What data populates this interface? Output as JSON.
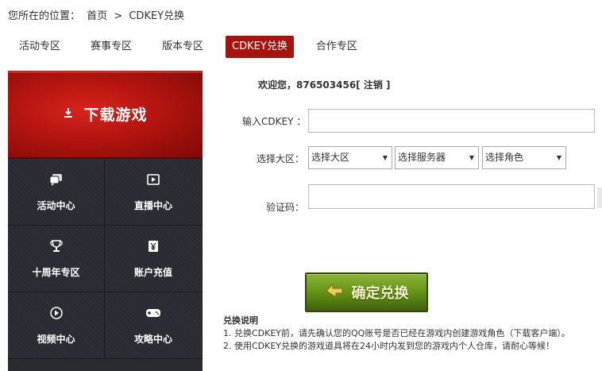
{
  "breadcrumb": {
    "prefix": "您所在的位置：",
    "home": "首页",
    "separator": ">",
    "current": "CDKEY兑换"
  },
  "tabs": [
    {
      "label": "活动专区",
      "active": false
    },
    {
      "label": "赛事专区",
      "active": false
    },
    {
      "label": "版本专区",
      "active": false
    },
    {
      "label": "CDKEY兑换",
      "active": true
    },
    {
      "label": "合作专区",
      "active": false
    }
  ],
  "sidebar": {
    "download_label": "下载游戏",
    "items": [
      {
        "label": "活动中心",
        "icon": "chat-icon"
      },
      {
        "label": "直播中心",
        "icon": "play-screen-icon"
      },
      {
        "label": "十周年专区",
        "icon": "trophy-icon"
      },
      {
        "label": "账户充值",
        "icon": "yen-icon"
      },
      {
        "label": "视频中心",
        "icon": "play-circle-icon"
      },
      {
        "label": "攻略中心",
        "icon": "gamepad-icon"
      }
    ]
  },
  "form": {
    "welcome_prefix": "欢迎您，",
    "username": "876503456",
    "logout": "[ 注销 ]",
    "cdkey_label": "输入CDKEY ：",
    "cdkey_value": "",
    "region_label": "选择大区：",
    "select_region": "选择大区",
    "select_server": "选择服务器",
    "select_role": "选择角色",
    "captcha_label": "验证码：",
    "captcha_value": "",
    "confirm_label": "确定兑换"
  },
  "notes": {
    "title": "兑换说明",
    "line1": "1. 兑换CDKEY前，请先确认您的QQ账号是否已经在游戏内创建游戏角色（下载客户端）。",
    "line2": "2. 使用CDKEY兑换的游戏道具将在24小时内发到您的游戏内个人仓库，请耐心等候！"
  },
  "colors": {
    "accent": "#a71410",
    "sidebar_bg": "#2a2a31",
    "button_green": "#6a9a1d"
  }
}
